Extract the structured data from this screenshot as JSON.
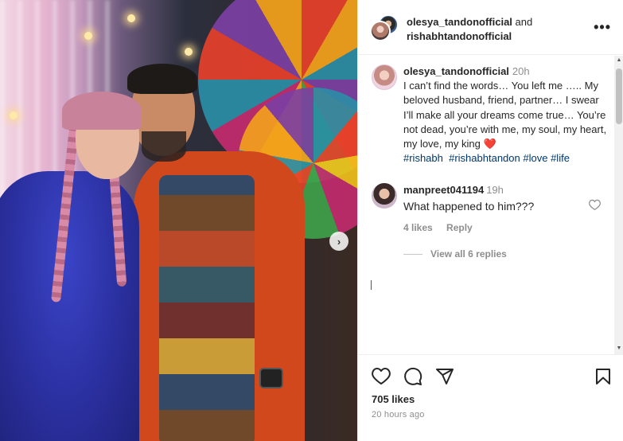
{
  "post": {
    "header": {
      "user1": "olesya_tandonofficial",
      "and_text": "and",
      "user2": "rishabhtandonofficial",
      "more_label": "•••"
    },
    "caption": {
      "username": "olesya_tandonofficial",
      "time": "20h",
      "text": "I can’t find the words… You left me ….. My beloved husband, friend, partner… I swear I’ll make all your dreams come true… You’re not dead, you’re with me, my soul, my heart, my love, my king",
      "emoji": "❤️",
      "hashtags": [
        "#rishabh",
        "#rishabhtandon",
        "#love",
        "#life"
      ]
    },
    "comment": {
      "username": "manpreet041194",
      "time": "19h",
      "text": "What happened to him???",
      "likes": "4 likes",
      "reply": "Reply",
      "view_replies": "View all 6 replies"
    },
    "likes": "705 likes",
    "posted_ago": "20 hours ago"
  },
  "icons": {
    "like": "heart-icon",
    "comment": "comment-icon",
    "share": "share-icon",
    "save": "bookmark-icon",
    "next": "chevron-right-icon",
    "more": "more-icon"
  },
  "colors": {
    "link": "#00376b",
    "muted": "#8e8e8e",
    "text": "#262626",
    "heart": "#e02020"
  }
}
